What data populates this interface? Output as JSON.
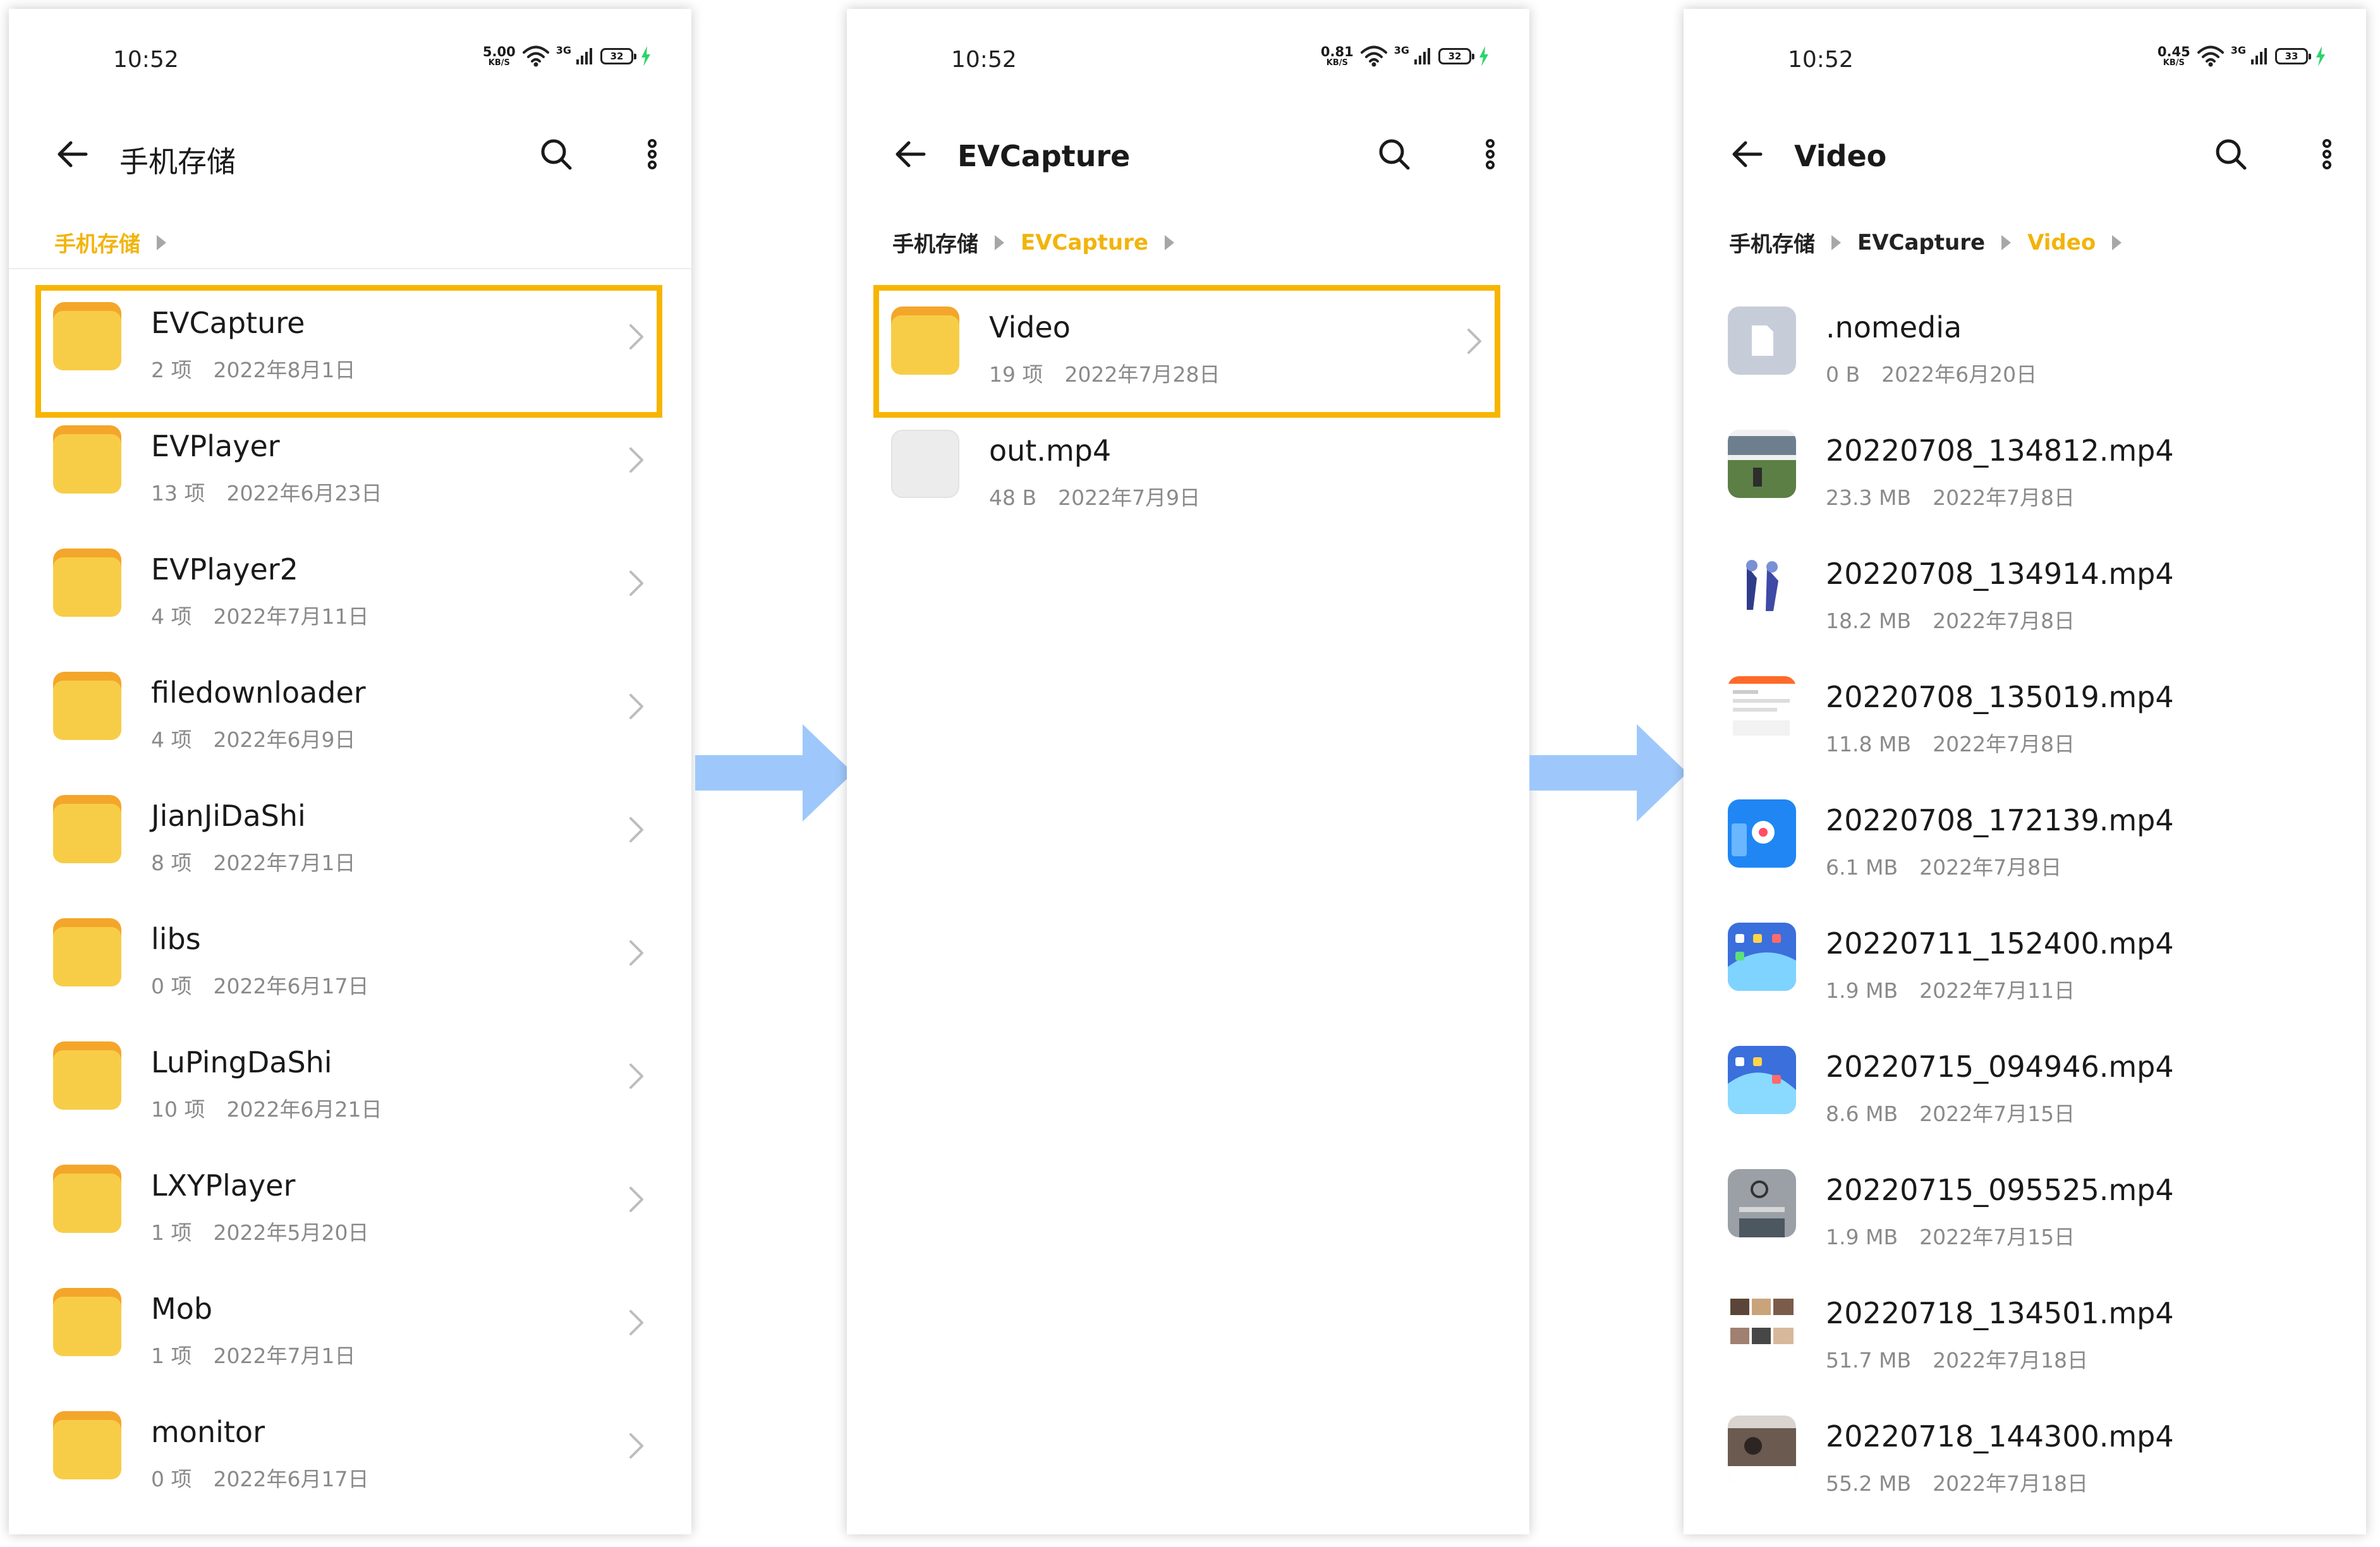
{
  "colors": {
    "accent": "#f2b40c",
    "highlight": "#f7b500",
    "folder": "#f7cd48",
    "folder_tab": "#f4a62a",
    "arrow": "#9ec8fb",
    "secondary_text": "#8a8a8a"
  },
  "screens": [
    {
      "status": {
        "time": "10:52",
        "speed_value": "5.00",
        "speed_unit": "KB/S",
        "network": "3G",
        "battery": "32"
      },
      "title": "手机存储",
      "crumbs": [
        "手机存储"
      ],
      "items": [
        {
          "name": "EVCapture",
          "count": "2 项",
          "date": "2022年8月1日",
          "icon": "folder-icon"
        },
        {
          "name": "EVPlayer",
          "count": "13 项",
          "date": "2022年6月23日",
          "icon": "folder-icon"
        },
        {
          "name": "EVPlayer2",
          "count": "4 项",
          "date": "2022年7月11日",
          "icon": "folder-icon"
        },
        {
          "name": "filedownloader",
          "count": "4 项",
          "date": "2022年6月9日",
          "icon": "folder-icon"
        },
        {
          "name": "JianJiDaShi",
          "count": "8 项",
          "date": "2022年7月1日",
          "icon": "folder-icon"
        },
        {
          "name": "libs",
          "count": "0 项",
          "date": "2022年6月17日",
          "icon": "folder-icon"
        },
        {
          "name": "LuPingDaShi",
          "count": "10 项",
          "date": "2022年6月21日",
          "icon": "folder-icon"
        },
        {
          "name": "LXYPlayer",
          "count": "1 项",
          "date": "2022年5月20日",
          "icon": "folder-icon"
        },
        {
          "name": "Mob",
          "count": "1 项",
          "date": "2022年7月1日",
          "icon": "folder-icon"
        },
        {
          "name": "monitor",
          "count": "0 项",
          "date": "2022年6月17日",
          "icon": "folder-icon"
        }
      ]
    },
    {
      "status": {
        "time": "10:52",
        "speed_value": "0.81",
        "speed_unit": "KB/S",
        "network": "3G",
        "battery": "32"
      },
      "title": "EVCapture",
      "crumbs": [
        "手机存储",
        "EVCapture"
      ],
      "items": [
        {
          "name": "Video",
          "count": "19 项",
          "date": "2022年7月28日",
          "icon": "folder-icon"
        },
        {
          "name": "out.mp4",
          "count": "48 B",
          "date": "2022年7月9日",
          "icon": "blank-thumbnail"
        }
      ]
    },
    {
      "status": {
        "time": "10:52",
        "speed_value": "0.45",
        "speed_unit": "KB/S",
        "network": "3G",
        "battery": "33"
      },
      "title": "Video",
      "crumbs": [
        "手机存储",
        "EVCapture",
        "Video"
      ],
      "items": [
        {
          "name": ".nomedia",
          "count": "0 B",
          "date": "2022年6月20日",
          "icon": "document-icon"
        },
        {
          "name": "20220708_134812.mp4",
          "count": "23.3 MB",
          "date": "2022年7月8日",
          "icon": "video-thumbnail"
        },
        {
          "name": "20220708_134914.mp4",
          "count": "18.2 MB",
          "date": "2022年7月8日",
          "icon": "video-thumbnail"
        },
        {
          "name": "20220708_135019.mp4",
          "count": "11.8 MB",
          "date": "2022年7月8日",
          "icon": "video-thumbnail"
        },
        {
          "name": "20220708_172139.mp4",
          "count": "6.1 MB",
          "date": "2022年7月8日",
          "icon": "video-thumbnail"
        },
        {
          "name": "20220711_152400.mp4",
          "count": "1.9 MB",
          "date": "2022年7月11日",
          "icon": "video-thumbnail"
        },
        {
          "name": "20220715_094946.mp4",
          "count": "8.6 MB",
          "date": "2022年7月15日",
          "icon": "video-thumbnail"
        },
        {
          "name": "20220715_095525.mp4",
          "count": "1.9 MB",
          "date": "2022年7月15日",
          "icon": "video-thumbnail"
        },
        {
          "name": "20220718_134501.mp4",
          "count": "51.7 MB",
          "date": "2022年7月18日",
          "icon": "video-thumbnail"
        },
        {
          "name": "20220718_144300.mp4",
          "count": "55.2 MB",
          "date": "2022年7月18日",
          "icon": "video-thumbnail"
        }
      ]
    }
  ]
}
